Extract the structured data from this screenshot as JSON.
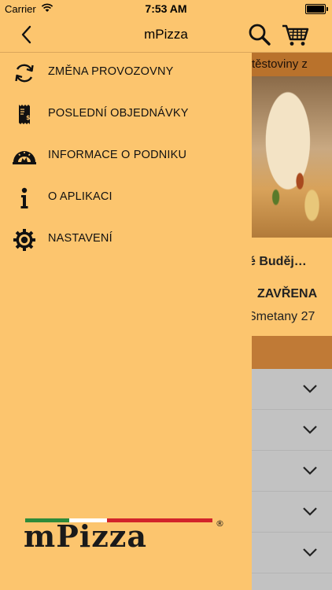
{
  "status_bar": {
    "carrier": "Carrier",
    "time": "7:53 AM"
  },
  "nav": {
    "title": "mPizza"
  },
  "menu": {
    "items": [
      {
        "label": "ZMĚNA PROVOZOVNY",
        "icon": "refresh-icon"
      },
      {
        "label": "POSLEDNÍ OBJEDNÁVKY",
        "icon": "receipt-icon"
      },
      {
        "label": "INFORMACE O PODNIKU",
        "icon": "oven-icon"
      },
      {
        "label": "O APLIKACI",
        "icon": "info-icon"
      },
      {
        "label": "NASTAVENÍ",
        "icon": "gear-icon"
      }
    ]
  },
  "background": {
    "promo_text": "těstoviny z",
    "restaurant_name": "é Buděj…",
    "restaurant_status": "ZAVŘENA",
    "restaurant_address": "Smetany 27"
  },
  "logo": {
    "text": "mPizza",
    "registered": "®"
  },
  "colors": {
    "drawer_bg": "#fcc56e",
    "header_bg": "#fcc56e",
    "band": "#c07a36",
    "logo_green": "#2e8b3a",
    "logo_red": "#d2232a",
    "logo_dark": "#1a1a1a"
  }
}
